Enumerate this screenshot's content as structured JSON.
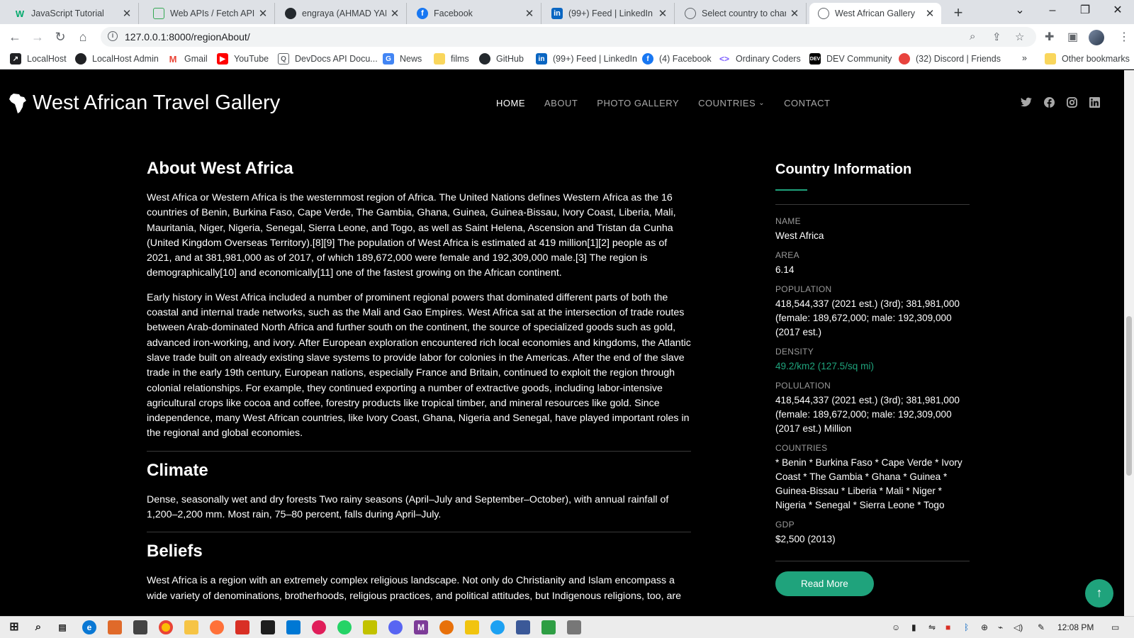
{
  "browser": {
    "tabs": [
      {
        "title": "JavaScript Tutorial",
        "favicon": "w3schools-icon",
        "color": "#04aa6d"
      },
      {
        "title": "Web APIs / Fetch API: U",
        "favicon": "page-icon",
        "color": "#34a853"
      },
      {
        "title": "engraya (AHMAD YAKU",
        "favicon": "github-icon",
        "color": "#24292e"
      },
      {
        "title": "Facebook",
        "favicon": "facebook-icon",
        "color": "#1877f2"
      },
      {
        "title": "(99+) Feed | LinkedIn",
        "favicon": "linkedin-icon",
        "color": "#0a66c2"
      },
      {
        "title": "Select country to chang",
        "favicon": "globe-icon",
        "color": "#5f6368"
      },
      {
        "title": "West African Gallery",
        "favicon": "globe-icon",
        "color": "#5f6368"
      }
    ],
    "url": "127.0.0.1:8000/regionAbout/",
    "bookmarks": [
      {
        "label": "LocalHost",
        "icon": "localhost-icon",
        "color": "#202124"
      },
      {
        "label": "LocalHost Admin",
        "icon": "globe-icon",
        "color": "#202124"
      },
      {
        "label": "Gmail",
        "icon": "gmail-icon",
        "color": "#ea4335"
      },
      {
        "label": "YouTube",
        "icon": "youtube-icon",
        "color": "#ff0000"
      },
      {
        "label": "DevDocs API Docu...",
        "icon": "devdocs-icon",
        "color": "#5f6368"
      },
      {
        "label": "News",
        "icon": "news-icon",
        "color": "#4285f4"
      },
      {
        "label": "films",
        "icon": "folder-icon",
        "color": "#f9d65c"
      },
      {
        "label": "GitHub",
        "icon": "github-icon",
        "color": "#24292e"
      },
      {
        "label": "(99+) Feed | LinkedIn",
        "icon": "linkedin-icon",
        "color": "#0a66c2"
      },
      {
        "label": "(4) Facebook",
        "icon": "facebook-icon",
        "color": "#1877f2"
      },
      {
        "label": "Ordinary Coders",
        "icon": "code-icon",
        "color": "#7b5cff"
      },
      {
        "label": "DEV Community",
        "icon": "dev-icon",
        "color": "#000000"
      },
      {
        "label": "(32) Discord | Friends",
        "icon": "discord-icon",
        "color": "#e8433e"
      }
    ],
    "other_bookmarks": "Other bookmarks",
    "more_bookmarks": "»"
  },
  "site": {
    "logo_text": "West African Travel Gallery",
    "nav": [
      {
        "label": "HOME",
        "active": true
      },
      {
        "label": "ABOUT",
        "active": false
      },
      {
        "label": "PHOTO GALLERY",
        "active": false
      },
      {
        "label": "COUNTRIES",
        "active": false,
        "dropdown": true
      },
      {
        "label": "CONTACT",
        "active": false
      }
    ],
    "social": [
      "twitter-icon",
      "facebook-icon",
      "instagram-icon",
      "linkedin-icon"
    ],
    "accent_color": "#1fa37c"
  },
  "main": {
    "about_title": "About West Africa",
    "about_p1": "West Africa or Western Africa is the westernmost region of Africa. The United Nations defines Western Africa as the 16 countries of Benin, Burkina Faso, Cape Verde, The Gambia, Ghana, Guinea, Guinea-Bissau, Ivory Coast, Liberia, Mali, Mauritania, Niger, Nigeria, Senegal, Sierra Leone, and Togo, as well as Saint Helena, Ascension and Tristan da Cunha (United Kingdom Overseas Territory).[8][9] The population of West Africa is estimated at 419 million[1][2] people as of 2021, and at 381,981,000 as of 2017, of which 189,672,000 were female and 192,309,000 male.[3] The region is demographically[10] and economically[11] one of the fastest growing on the African continent.",
    "about_p2": "Early history in West Africa included a number of prominent regional powers that dominated different parts of both the coastal and internal trade networks, such as the Mali and Gao Empires. West Africa sat at the intersection of trade routes between Arab-dominated North Africa and further south on the continent, the source of specialized goods such as gold, advanced iron-working, and ivory. After European exploration encountered rich local economies and kingdoms, the Atlantic slave trade built on already existing slave systems to provide labor for colonies in the Americas. After the end of the slave trade in the early 19th century, European nations, especially France and Britain, continued to exploit the region through colonial relationships. For example, they continued exporting a number of extractive goods, including labor-intensive agricultural crops like cocoa and coffee, forestry products like tropical timber, and mineral resources like gold. Since independence, many West African countries, like Ivory Coast, Ghana, Nigeria and Senegal, have played important roles in the regional and global economies.",
    "climate_title": "Climate",
    "climate_p": "Dense, seasonally wet and dry forests Two rainy seasons (April–July and September–October), with annual rainfall of 1,200–2,200 mm. Most rain, 75–80 percent, falls during April–July.",
    "beliefs_title": "Beliefs",
    "beliefs_p": "West Africa is a region with an extremely complex religious landscape. Not only do Christianity and Islam encompass a wide variety of denominations, brotherhoods, religious practices, and political attitudes, but Indigenous religions, too, are"
  },
  "sidebar": {
    "title": "Country Information",
    "items": [
      {
        "label": "NAME",
        "value": "West Africa"
      },
      {
        "label": "AREA",
        "value": "6.14"
      },
      {
        "label": "POPULATION",
        "value": "418,544,337 (2021 est.) (3rd); 381,981,000 (female: 189,672,000; male: 192,309,000 (2017 est.)"
      },
      {
        "label": "DENSITY",
        "value": "49.2/km2 (127.5/sq mi)"
      },
      {
        "label": "POLULATION",
        "value": "418,544,337 (2021 est.) (3rd); 381,981,000 (female: 189,672,000; male: 192,309,000 (2017 est.) Million"
      },
      {
        "label": "COUNTRIES",
        "value": "* Benin * Burkina Faso * Cape Verde * Ivory Coast * The Gambia * Ghana * Guinea * Guinea-Bissau * Liberia * Mali * Niger * Nigeria * Senegal * Sierra Leone * Togo"
      },
      {
        "label": "GDP",
        "value": "$2,500 (2013)"
      }
    ],
    "read_more": "Read More"
  },
  "back_to_top": "↑",
  "taskbar": {
    "time": "12:08 PM"
  }
}
